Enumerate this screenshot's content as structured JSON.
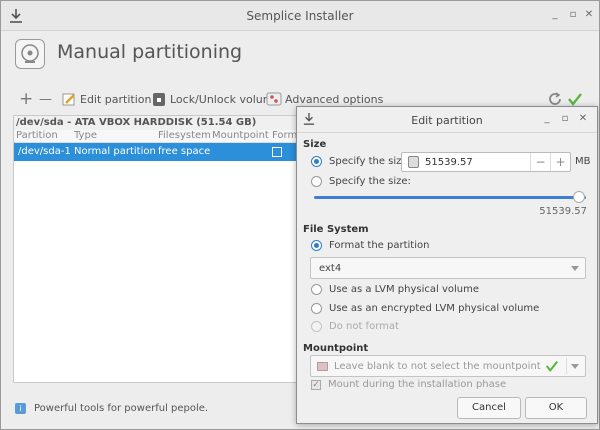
{
  "window": {
    "title": "Semplice Installer",
    "minimize": "_",
    "maximize": "▫",
    "close": "✕"
  },
  "header": {
    "title": "Manual partitioning",
    "icon": "disk-icon"
  },
  "toolbar": {
    "add": "+",
    "remove": "—",
    "edit_label": "Edit partition",
    "lock_label": "Lock/Unlock volume",
    "advanced_label": "Advanced options"
  },
  "disk": {
    "title": "/dev/sda - ATA VBOX HARDDISK (51.54 GB)",
    "columns": [
      "Partition",
      "Type",
      "Filesystem",
      "Mountpoint",
      "Format"
    ],
    "rows": [
      {
        "partition": "/dev/sda-1",
        "type": "Normal partition",
        "filesystem": "free space",
        "mountpoint": ""
      }
    ]
  },
  "footer": {
    "text": "Powerful tools for powerful pepole."
  },
  "dialog": {
    "title": "Edit partition",
    "minimize": "_",
    "maximize": "▫",
    "close": "✕",
    "size_section": "Size",
    "specify_size_1": "Specify the size:",
    "size_value": "51539.57",
    "spin_minus": "−",
    "spin_plus": "+",
    "unit": "MB",
    "specify_size_2": "Specify the size:",
    "slider_value": "51539.57",
    "slider_fraction": 1.0,
    "fs_section": "File System",
    "format_partition": "Format the partition",
    "fs_selected": "ext4",
    "lvm": "Use as a LVM physical volume",
    "encrypted_lvm": "Use as an encrypted LVM physical volume",
    "no_format": "Do not format",
    "mount_section": "Mountpoint",
    "mount_placeholder": "Leave blank to not select the mountpoint",
    "mount_during_install": "Mount during the installation phase",
    "cancel": "Cancel",
    "ok": "OK"
  },
  "colors": {
    "accent": "#2c8fd9",
    "check_green": "#5cb73a"
  }
}
